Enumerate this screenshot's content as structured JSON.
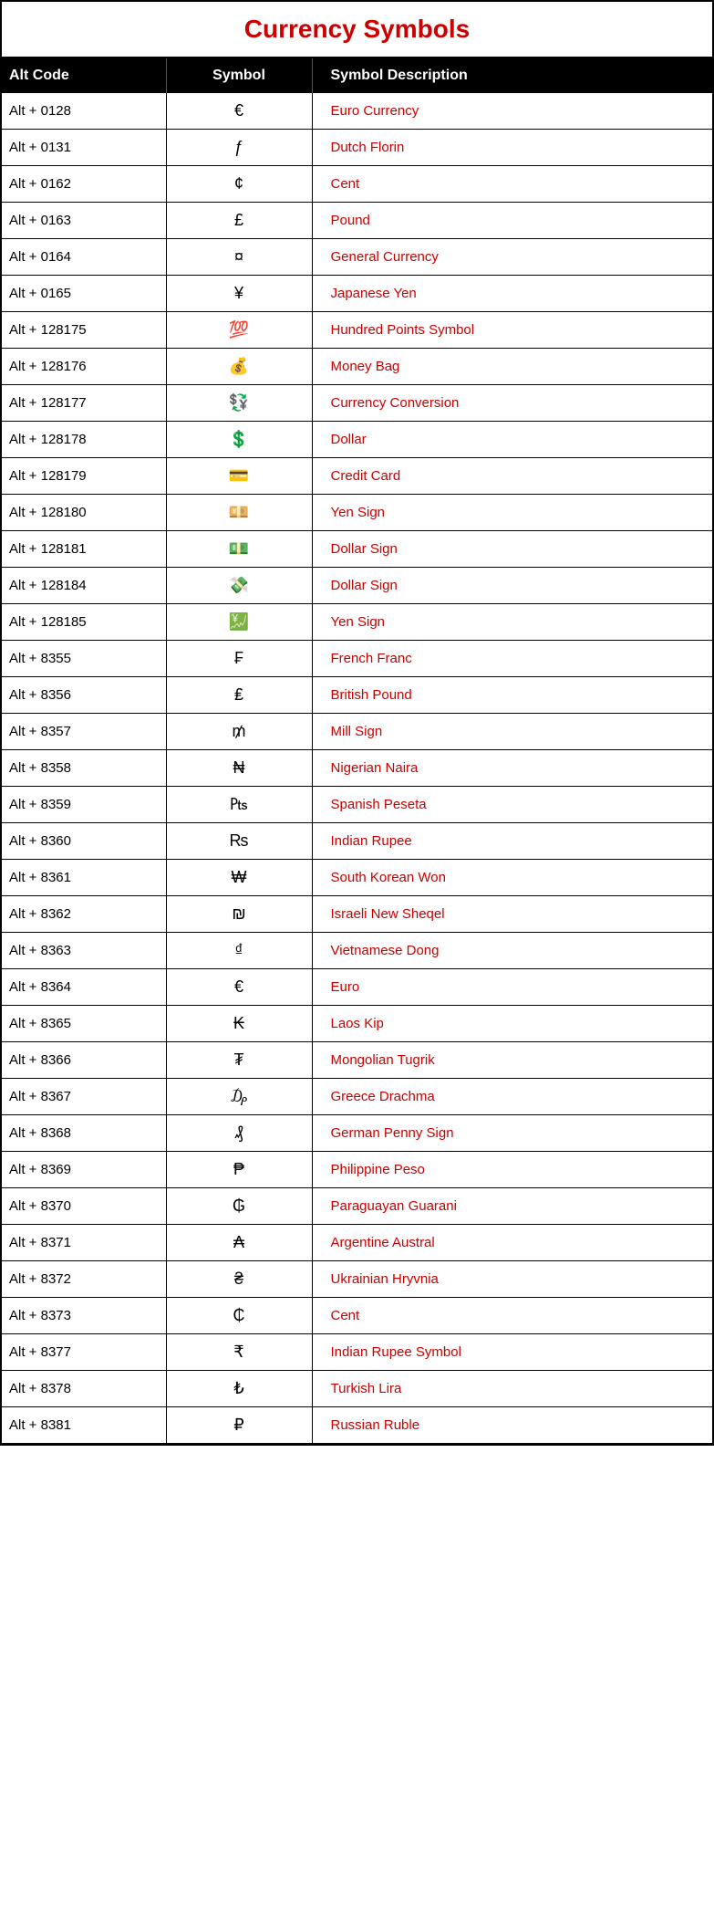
{
  "title": "Currency Symbols",
  "headers": [
    "Alt Code",
    "Symbol",
    "Symbol Description"
  ],
  "rows": [
    {
      "alt_code": "Alt + 0128",
      "symbol": "€",
      "description": "Euro Currency"
    },
    {
      "alt_code": "Alt + 0131",
      "symbol": "ƒ",
      "description": "Dutch Florin"
    },
    {
      "alt_code": "Alt + 0162",
      "symbol": "¢",
      "description": "Cent"
    },
    {
      "alt_code": "Alt + 0163",
      "symbol": "£",
      "description": "Pound"
    },
    {
      "alt_code": "Alt + 0164",
      "symbol": "¤",
      "description": "General Currency"
    },
    {
      "alt_code": "Alt + 0165",
      "symbol": "¥",
      "description": "Japanese Yen"
    },
    {
      "alt_code": "Alt + 128175",
      "symbol": "💯",
      "description": "Hundred Points Symbol"
    },
    {
      "alt_code": "Alt + 128176",
      "symbol": "💰",
      "description": "Money Bag"
    },
    {
      "alt_code": "Alt + 128177",
      "symbol": "💱",
      "description": "Currency Conversion"
    },
    {
      "alt_code": "Alt + 128178",
      "symbol": "💲",
      "description": "Dollar"
    },
    {
      "alt_code": "Alt + 128179",
      "symbol": "💳",
      "description": "Credit Card"
    },
    {
      "alt_code": "Alt + 128180",
      "symbol": "💴",
      "description": "Yen Sign"
    },
    {
      "alt_code": "Alt + 128181",
      "symbol": "💵",
      "description": "Dollar Sign"
    },
    {
      "alt_code": "Alt + 128184",
      "symbol": "💸",
      "description": "Dollar Sign"
    },
    {
      "alt_code": "Alt + 128185",
      "symbol": "💹",
      "description": "Yen Sign"
    },
    {
      "alt_code": "Alt + 8355",
      "symbol": "₣",
      "description": "French Franc"
    },
    {
      "alt_code": "Alt + 8356",
      "symbol": "₤",
      "description": "British Pound"
    },
    {
      "alt_code": "Alt + 8357",
      "symbol": "₥",
      "description": "Mill Sign"
    },
    {
      "alt_code": "Alt + 8358",
      "symbol": "₦",
      "description": "Nigerian Naira"
    },
    {
      "alt_code": "Alt + 8359",
      "symbol": "₧",
      "description": "Spanish Peseta"
    },
    {
      "alt_code": "Alt + 8360",
      "symbol": "₨",
      "description": "Indian Rupee"
    },
    {
      "alt_code": "Alt + 8361",
      "symbol": "₩",
      "description": "South Korean Won"
    },
    {
      "alt_code": "Alt + 8362",
      "symbol": "₪",
      "description": "Israeli New Sheqel"
    },
    {
      "alt_code": "Alt + 8363",
      "symbol": "₫",
      "description": "Vietnamese Dong"
    },
    {
      "alt_code": "Alt + 8364",
      "symbol": "€",
      "description": "Euro"
    },
    {
      "alt_code": "Alt + 8365",
      "symbol": "₭",
      "description": "Laos Kip"
    },
    {
      "alt_code": "Alt + 8366",
      "symbol": "₮",
      "description": "Mongolian Tugrik"
    },
    {
      "alt_code": "Alt + 8367",
      "symbol": "₯",
      "description": "Greece Drachma"
    },
    {
      "alt_code": "Alt + 8368",
      "symbol": "₰",
      "description": "German Penny  Sign"
    },
    {
      "alt_code": "Alt + 8369",
      "symbol": "₱",
      "description": "Philippine Peso"
    },
    {
      "alt_code": "Alt + 8370",
      "symbol": "₲",
      "description": "Paraguayan Guarani"
    },
    {
      "alt_code": "Alt + 8371",
      "symbol": "₳",
      "description": "Argentine Austral"
    },
    {
      "alt_code": "Alt + 8372",
      "symbol": "₴",
      "description": "Ukrainian Hryvnia"
    },
    {
      "alt_code": "Alt + 8373",
      "symbol": "₵",
      "description": "Cent"
    },
    {
      "alt_code": "Alt + 8377",
      "symbol": "₹",
      "description": "Indian Rupee Symbol"
    },
    {
      "alt_code": "Alt + 8378",
      "symbol": "₺",
      "description": "Turkish Lira"
    },
    {
      "alt_code": "Alt + 8381",
      "symbol": "₽",
      "description": "Russian Ruble"
    }
  ]
}
